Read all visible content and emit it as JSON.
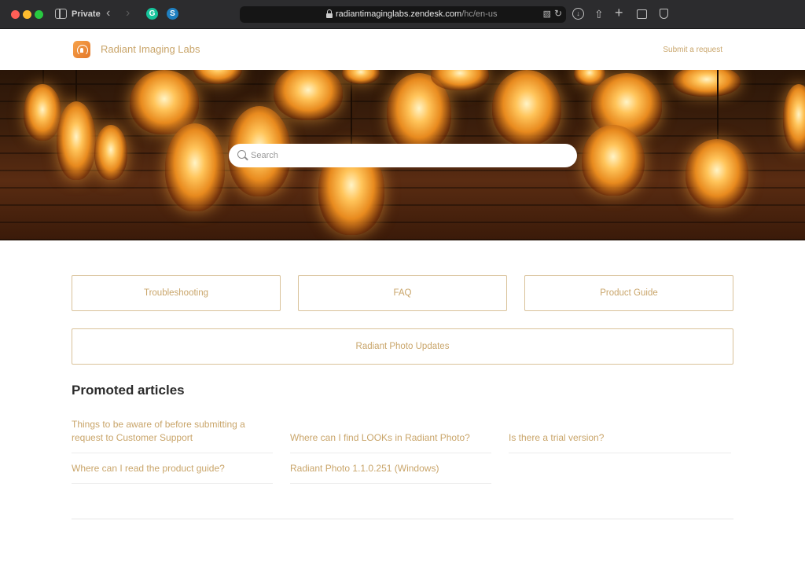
{
  "browser": {
    "private_label": "Private",
    "url_host": "radiantimaginglabs.zendesk.com",
    "url_path": "/hc/en-us",
    "extensions": [
      "G",
      "S"
    ]
  },
  "header": {
    "brand": "Radiant Imaging Labs",
    "submit_request": "Submit a request"
  },
  "search": {
    "placeholder": "Search"
  },
  "categories": [
    {
      "label": "Troubleshooting"
    },
    {
      "label": "FAQ"
    },
    {
      "label": "Product Guide"
    },
    {
      "label": "Radiant Photo Updates"
    }
  ],
  "promoted": {
    "title": "Promoted articles",
    "articles": [
      {
        "title": "Things to be aware of before submitting a request to Customer Support"
      },
      {
        "title": "Where can I find LOOKs in Radiant Photo?"
      },
      {
        "title": "Is there a trial version?"
      },
      {
        "title": "Where can I read the product guide?"
      },
      {
        "title": "Radiant Photo 1.1.0.251 (Windows)"
      }
    ]
  },
  "colors": {
    "accent": "#c9a56a",
    "card_border": "#d9c29a",
    "heading": "#2b2b2b"
  }
}
